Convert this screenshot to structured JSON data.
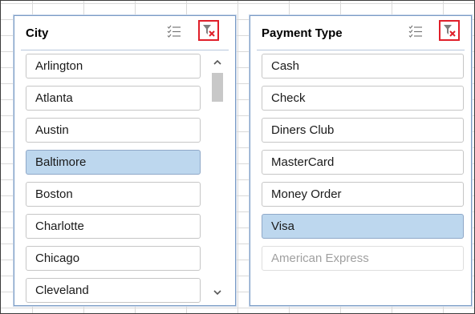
{
  "city_slicer": {
    "title": "City",
    "multi_select_icon": "multi-select-icon",
    "clear_filter_icon": "clear-filter-icon",
    "items": [
      {
        "label": "Arlington",
        "selected": false
      },
      {
        "label": "Atlanta",
        "selected": false
      },
      {
        "label": "Austin",
        "selected": false
      },
      {
        "label": "Baltimore",
        "selected": true
      },
      {
        "label": "Boston",
        "selected": false
      },
      {
        "label": "Charlotte",
        "selected": false
      },
      {
        "label": "Chicago",
        "selected": false
      },
      {
        "label": "Cleveland",
        "selected": false
      }
    ]
  },
  "payment_slicer": {
    "title": "Payment Type",
    "multi_select_icon": "multi-select-icon",
    "clear_filter_icon": "clear-filter-icon",
    "items": [
      {
        "label": "Cash",
        "selected": false
      },
      {
        "label": "Check",
        "selected": false
      },
      {
        "label": "Diners Club",
        "selected": false
      },
      {
        "label": "MasterCard",
        "selected": false
      },
      {
        "label": "Money Order",
        "selected": false
      },
      {
        "label": "Visa",
        "selected": true
      },
      {
        "label": "American Express",
        "selected": false,
        "no_data": true
      }
    ]
  },
  "colors": {
    "selected_item": "#bdd7ee",
    "clear_filter_highlight": "#e01f2a",
    "slicer_border": "#7a9cc6"
  }
}
